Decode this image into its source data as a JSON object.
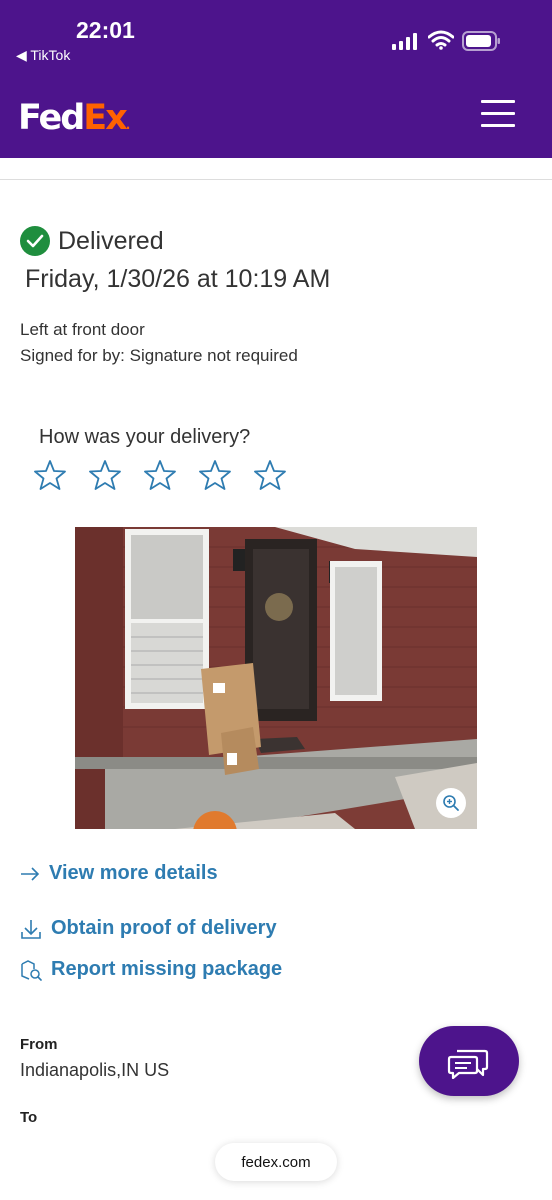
{
  "status_bar": {
    "time": "22:01",
    "back_app": "◀ TikTok"
  },
  "header": {
    "logo_fed": "Fed",
    "logo_ex": "Ex",
    "logo_dot": "."
  },
  "shipment": {
    "status": "Delivered",
    "date": "Friday, 1/30/26 at 10:19 AM",
    "location_note": "Left at front door",
    "signed_for": "Signed for by: Signature not required"
  },
  "rating": {
    "question": "How was your delivery?",
    "max_stars": 5,
    "selected": 0
  },
  "photo": {
    "description_icon": "delivery-photo",
    "zoom_icon": "zoom-in-icon"
  },
  "links": {
    "view_details": "View more details",
    "proof": "Obtain proof of delivery",
    "report_missing": "Report missing package"
  },
  "addresses": {
    "from_label": "From",
    "from_value": "Indianapolis,IN US",
    "to_label": "To"
  },
  "browser": {
    "url": "fedex.com"
  },
  "colors": {
    "brand_purple": "#4d148c",
    "brand_orange": "#ff6200",
    "link_blue": "#2e7cb1",
    "success_green": "#1f8e3e"
  }
}
